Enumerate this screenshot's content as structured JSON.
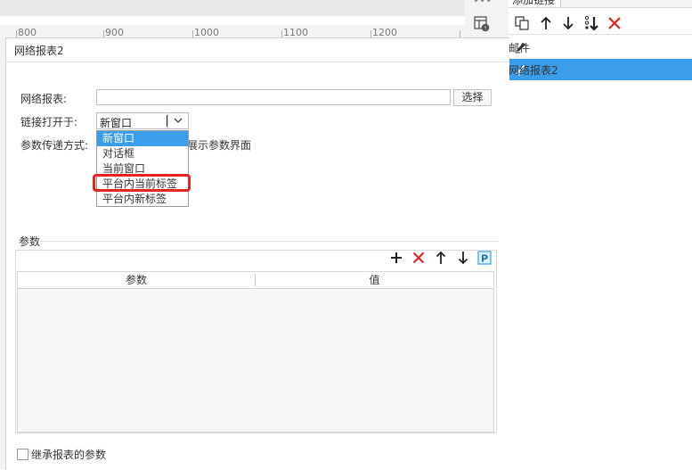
{
  "ruler": {
    "ticks": [
      "800",
      "900",
      "1000",
      "1100",
      "1200"
    ]
  },
  "right_panel": {
    "title": "添加链接",
    "items": [
      {
        "label": "邮件",
        "selected": false
      },
      {
        "label": "网络报表2",
        "selected": true
      }
    ]
  },
  "dialog": {
    "title": "网络报表2",
    "report_label": "网络报表:",
    "report_value": "",
    "select_button": "选择",
    "open_in_label": "链接打开于:",
    "open_in_value": "新窗口",
    "param_mode_label": "参数传递方式:",
    "show_param_text": "展示参数界面",
    "dropdown_options": [
      {
        "label": "新窗口",
        "selected": true
      },
      {
        "label": "对话框",
        "selected": false
      },
      {
        "label": "当前窗口",
        "selected": false
      },
      {
        "label": "平台内当前标签",
        "selected": false,
        "highlighted": true
      },
      {
        "label": "平台内新标签",
        "selected": false
      }
    ],
    "params_group_label": "参数",
    "columns": [
      "参数",
      "值"
    ],
    "inherit_params_label": "继承报表的参数",
    "inherit_params_checked": false
  },
  "colors": {
    "accent": "#3c9dea",
    "highlight_border": "#e5231f",
    "delete_icon": "#e5231f"
  }
}
